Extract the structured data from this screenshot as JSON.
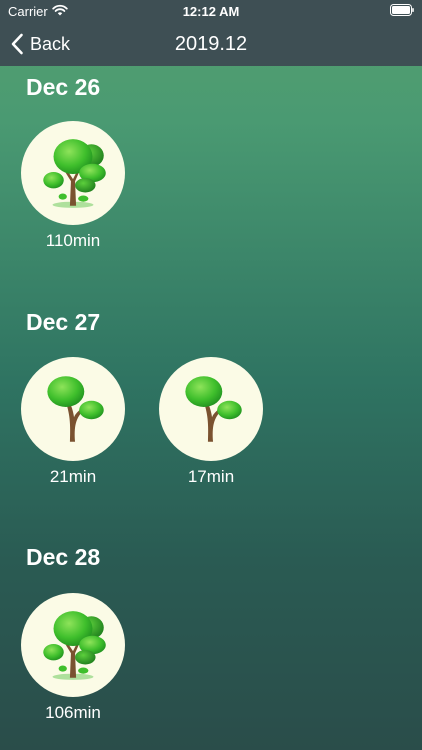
{
  "status_bar": {
    "carrier": "Carrier",
    "time": "12:12 AM"
  },
  "nav": {
    "back_label": "Back",
    "title": "2019.12"
  },
  "days": [
    {
      "date": "Dec 26",
      "sessions": [
        {
          "duration": "110min",
          "tree": "big-tree-icon"
        }
      ]
    },
    {
      "date": "Dec 27",
      "sessions": [
        {
          "duration": "21min",
          "tree": "small-tree-icon"
        },
        {
          "duration": "17min",
          "tree": "small-tree-icon"
        }
      ]
    },
    {
      "date": "Dec 28",
      "sessions": [
        {
          "duration": "106min",
          "tree": "big-tree-icon"
        }
      ]
    }
  ],
  "colors": {
    "bar": "#3e4f54",
    "circle_bg": "#fbfbe6",
    "leaf": "#34b82a",
    "trunk": "#7a5230"
  }
}
